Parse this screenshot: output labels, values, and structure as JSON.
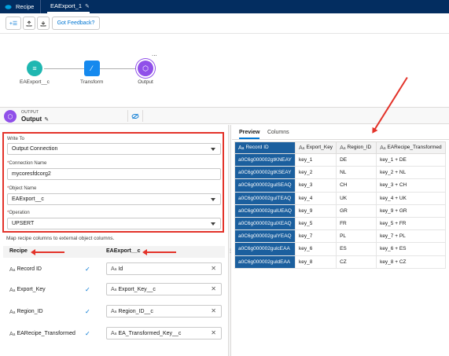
{
  "topbar": {
    "logo_icon": "salesforce-cloud-icon",
    "tabs": [
      "Recipe",
      "EAExport_1"
    ],
    "edit_icon": "pencil-icon"
  },
  "toolbar": {
    "icons": [
      "add-data-icon",
      "upload-icon",
      "download-icon"
    ],
    "feedback_label": "Got Feedback?"
  },
  "canvas": {
    "more": "...",
    "nodes": [
      {
        "label": "EAExport__c",
        "icon": "database-icon",
        "color": "#1fb7b1"
      },
      {
        "label": "Transform",
        "icon": "wand-icon",
        "color": "#1589ee"
      },
      {
        "label": "Output",
        "icon": "output-hexagon-icon",
        "color": "#9050e9"
      }
    ]
  },
  "output": {
    "kicker": "OUTPUT",
    "name": "Output"
  },
  "form": {
    "write_to_label": "Write To",
    "write_to_value": "Output Connection",
    "connection_label": "Connection Name",
    "connection_value": "mycoresfdcorg2",
    "object_label": "Object Name",
    "object_value": "EAExport__c",
    "operation_label": "Operation",
    "operation_value": "UPSERT",
    "required_mark": "*"
  },
  "mapping": {
    "hint": "Map recipe columns to external object columns.",
    "col_recipe": "Recipe",
    "col_target": "EAExport__c",
    "type_glyph_a": "A",
    "type_glyph_b": "a",
    "rows": [
      {
        "source": "Record ID",
        "target": "Id"
      },
      {
        "source": "Export_Key",
        "target": "Export_Key__c"
      },
      {
        "source": "Region_ID",
        "target": "Region_ID__c"
      },
      {
        "source": "EARecipe_Transformed",
        "target": "EA_Transformed_Key__c"
      }
    ]
  },
  "preview": {
    "tabs": [
      "Preview",
      "Columns"
    ],
    "columns": [
      "Record ID",
      "Export_Key",
      "Region_ID",
      "EARecipe_Transformed"
    ],
    "rows": [
      [
        "a0C6g000002gtKNEAY",
        "key_1",
        "DE",
        "key_1 + DE"
      ],
      [
        "a0C6g000002gtKSEAY",
        "key_2",
        "NL",
        "key_2 + NL"
      ],
      [
        "a0C6g000002gulSEAQ",
        "key_3",
        "CH",
        "key_3 + CH"
      ],
      [
        "a0C6g000002gulTEAQ",
        "key_4",
        "UK",
        "key_4 + UK"
      ],
      [
        "a0C6g000002gulUEAQ",
        "key_9",
        "GR",
        "key_9 + GR"
      ],
      [
        "a0C6g000002gulXEAQ",
        "key_5",
        "FR",
        "key_5 + FR"
      ],
      [
        "a0C6g000002gulYEAQ",
        "key_7",
        "PL",
        "key_7 + PL"
      ],
      [
        "a0C6g000002gulcEAA",
        "key_6",
        "ES",
        "key_6 + ES"
      ],
      [
        "a0C6g000002guldEAA",
        "key_8",
        "CZ",
        "key_8 + CZ"
      ]
    ]
  },
  "colors": {
    "topbar": "#032d60",
    "accent": "#0176d3",
    "annotation": "#e3332a",
    "selected_column": "#1b5f9e"
  }
}
